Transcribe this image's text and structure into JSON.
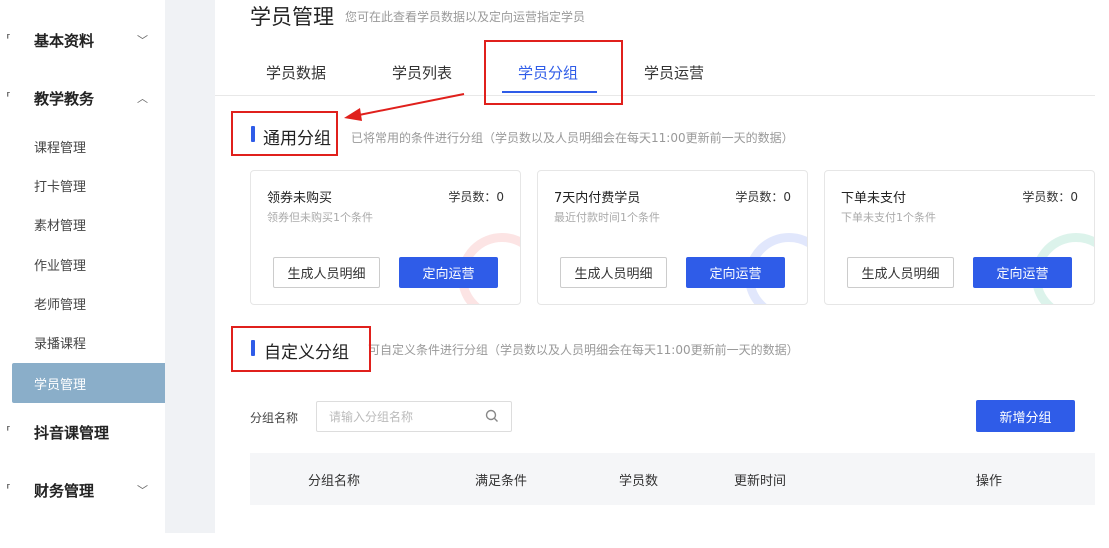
{
  "sidebar": {
    "groups": [
      {
        "label": "基本资料",
        "chevron": "﹀"
      },
      {
        "label": "教学教务",
        "chevron": "︿"
      },
      {
        "label": "抖音课管理",
        "chevron": ""
      },
      {
        "label": "财务管理",
        "chevron": "﹀"
      }
    ],
    "items": [
      {
        "label": "课程管理"
      },
      {
        "label": "打卡管理"
      },
      {
        "label": "素材管理"
      },
      {
        "label": "作业管理"
      },
      {
        "label": "老师管理"
      },
      {
        "label": "录播课程"
      },
      {
        "label": "学员管理"
      }
    ]
  },
  "header": {
    "title": "学员管理",
    "subtitle": "您可在此查看学员数据以及定向运营指定学员"
  },
  "tabs": [
    {
      "label": "学员数据"
    },
    {
      "label": "学员列表"
    },
    {
      "label": "学员分组"
    },
    {
      "label": "学员运营"
    }
  ],
  "common_section": {
    "title": "通用分组",
    "desc": "已将常用的条件进行分组（学员数以及人员明细会在每天11:00更新前一天的数据）",
    "cards": [
      {
        "name": "领券未购买",
        "count": "学员数：0",
        "cond": "领券但未购买1个条件",
        "detail_btn": "生成人员明细",
        "op_btn": "定向运营",
        "deco_color": "#f06a6a"
      },
      {
        "name": "7天内付费学员",
        "count": "学员数：0",
        "cond": "最近付款时间1个条件",
        "detail_btn": "生成人员明细",
        "op_btn": "定向运营",
        "deco_color": "#5b7cf0"
      },
      {
        "name": "下单未支付",
        "count": "学员数：0",
        "cond": "下单未支付1个条件",
        "detail_btn": "生成人员明细",
        "op_btn": "定向运营",
        "deco_color": "#3fbf8f"
      }
    ]
  },
  "custom_section": {
    "title": "自定义分组",
    "desc": "可自定义条件进行分组（学员数以及人员明细会在每天11:00更新前一天的数据）"
  },
  "filter": {
    "label": "分组名称",
    "placeholder": "请输入分组名称",
    "add_btn": "新增分组"
  },
  "table": {
    "columns": [
      "分组名称",
      "满足条件",
      "学员数",
      "更新时间",
      "操作"
    ]
  },
  "colors": {
    "accent": "#2f5ce8",
    "annotation": "#e0201c",
    "active_nav": "#8aaec9"
  }
}
